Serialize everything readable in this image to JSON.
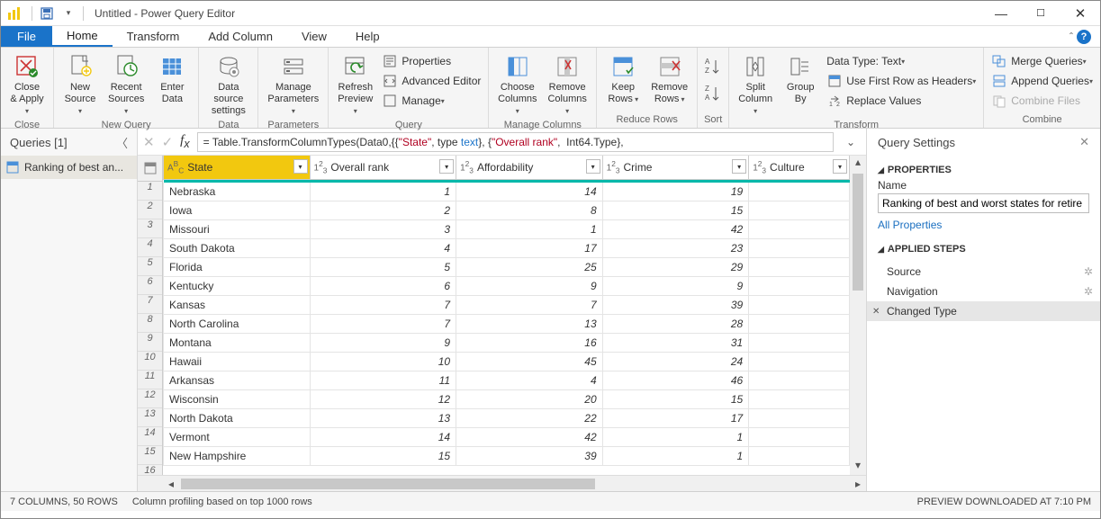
{
  "title": "Untitled - Power Query Editor",
  "tabs": {
    "file": "File",
    "home": "Home",
    "transform": "Transform",
    "add": "Add Column",
    "view": "View",
    "help": "Help"
  },
  "ribbon": {
    "close_apply": "Close &\nApply",
    "close_grp": "Close",
    "new_source": "New\nSource",
    "recent_sources": "Recent\nSources",
    "enter_data": "Enter\nData",
    "new_query": "New Query",
    "data_source": "Data source\nsettings",
    "data_sources": "Data Sources",
    "manage_params": "Manage\nParameters",
    "parameters": "Parameters",
    "refresh": "Refresh\nPreview",
    "properties": "Properties",
    "adv_editor": "Advanced Editor",
    "manage": "Manage",
    "query": "Query",
    "choose_cols": "Choose\nColumns",
    "remove_cols": "Remove\nColumns",
    "manage_cols": "Manage Columns",
    "keep_rows": "Keep\nRows",
    "remove_rows": "Remove\nRows",
    "reduce_rows": "Reduce Rows",
    "sort": "Sort",
    "split_col": "Split\nColumn",
    "group_by": "Group\nBy",
    "data_type": "Data Type: Text",
    "first_row": "Use First Row as Headers",
    "replace": "Replace Values",
    "transform": "Transform",
    "merge": "Merge Queries",
    "append": "Append Queries",
    "combine_files": "Combine Files",
    "combine": "Combine"
  },
  "queries": {
    "header": "Queries [1]",
    "item": "Ranking of best an..."
  },
  "formula": {
    "pre": "= Table.TransformColumnTypes(Data0,{{",
    "s": "\"State\"",
    ", type ": "",
    "text": "text",
    "mid": "}, {",
    "or": "\"Overall rank\"",
    ", ": "",
    "int": "Int64.Type",
    "end": "},"
  },
  "table": {
    "headers": [
      "State",
      "Overall rank",
      "Affordability",
      "Crime",
      "Culture"
    ],
    "rows": [
      [
        "Nebraska",
        "1",
        "14",
        "19",
        ""
      ],
      [
        "Iowa",
        "2",
        "8",
        "15",
        ""
      ],
      [
        "Missouri",
        "3",
        "1",
        "42",
        ""
      ],
      [
        "South Dakota",
        "4",
        "17",
        "23",
        ""
      ],
      [
        "Florida",
        "5",
        "25",
        "29",
        ""
      ],
      [
        "Kentucky",
        "6",
        "9",
        "9",
        ""
      ],
      [
        "Kansas",
        "7",
        "7",
        "39",
        ""
      ],
      [
        "North Carolina",
        "7",
        "13",
        "28",
        ""
      ],
      [
        "Montana",
        "9",
        "16",
        "31",
        ""
      ],
      [
        "Hawaii",
        "10",
        "45",
        "24",
        ""
      ],
      [
        "Arkansas",
        "11",
        "4",
        "46",
        ""
      ],
      [
        "Wisconsin",
        "12",
        "20",
        "15",
        ""
      ],
      [
        "North Dakota",
        "13",
        "22",
        "17",
        ""
      ],
      [
        "Vermont",
        "14",
        "42",
        "1",
        ""
      ],
      [
        "New Hampshire",
        "15",
        "39",
        "1",
        ""
      ]
    ]
  },
  "settings": {
    "title": "Query Settings",
    "props": "PROPERTIES",
    "name": "Name",
    "name_val": "Ranking of best and worst states for retire",
    "all_props": "All Properties",
    "applied": "APPLIED STEPS",
    "steps": [
      "Source",
      "Navigation",
      "Changed Type"
    ]
  },
  "status": {
    "cols": "7 COLUMNS, 50 ROWS",
    "prof": "Column profiling based on top 1000 rows",
    "dl": "PREVIEW DOWNLOADED AT 7:10 PM"
  }
}
